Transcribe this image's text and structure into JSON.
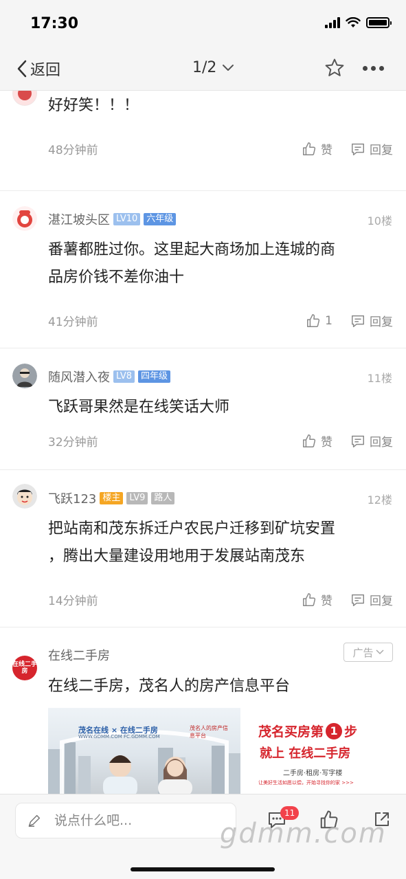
{
  "status_bar": {
    "time": "17:30"
  },
  "nav": {
    "back_label": "返回",
    "page_indicator": "1/2"
  },
  "comments": [
    {
      "username": "",
      "text": "好好笑！！！",
      "time": "48分钟前",
      "like_label": "赞",
      "reply_label": "回复"
    },
    {
      "username": "湛江坡头区",
      "level": "LV10",
      "grade": "六年级",
      "floor": "10楼",
      "text_line1": "番薯都胜过你。这里起大商场加上连城的商",
      "text_line2": "品房价钱不差你油十",
      "time": "41分钟前",
      "like_count": "1",
      "reply_label": "回复"
    },
    {
      "username": "随风潜入夜",
      "level": "LV8",
      "grade": "四年级",
      "floor": "11楼",
      "text": "飞跃哥果然是在线笑话大师",
      "time": "32分钟前",
      "like_label": "赞",
      "reply_label": "回复"
    },
    {
      "username": "飞跃123",
      "host_tag": "楼主",
      "level": "LV9",
      "grade": "路人",
      "floor": "12楼",
      "text_line1": "把站南和茂东拆迁户农民户迁移到矿坑安置",
      "text_line2": "，腾出大量建设用地用于发展站南茂东",
      "time": "14分钟前",
      "like_label": "赞",
      "reply_label": "回复"
    }
  ],
  "ad": {
    "avatar_text": "在线二手房",
    "name": "在线二手房",
    "tag": "广告",
    "text": "在线二手房，茂名人的房产信息平台",
    "banner_logo": "茂名在线 × 在线二手房",
    "banner_site": "WWW.GDMM.COM  FC.GDMM.COM",
    "banner_sub": "茂名人的房产信息平台",
    "slogan_line1": "茂名买房第",
    "slogan_num": "1",
    "slogan_step": "步",
    "slogan_line2": "就上 在线二手房",
    "slogan_line3": "二手房·租房·写字楼",
    "slogan_line4": "让美好生活如愿以偿，开始寻找你的家 >>>"
  },
  "bottom_bar": {
    "input_placeholder": "说点什么吧...",
    "comment_count": "11",
    "watermark": "gdmm.com"
  },
  "colors": {
    "level_badge": "#9cc0ee",
    "grade_badge": "#5d95e3",
    "host_badge": "#f5a623",
    "ad_red": "#d6252d",
    "count_badge": "#f2424b"
  }
}
